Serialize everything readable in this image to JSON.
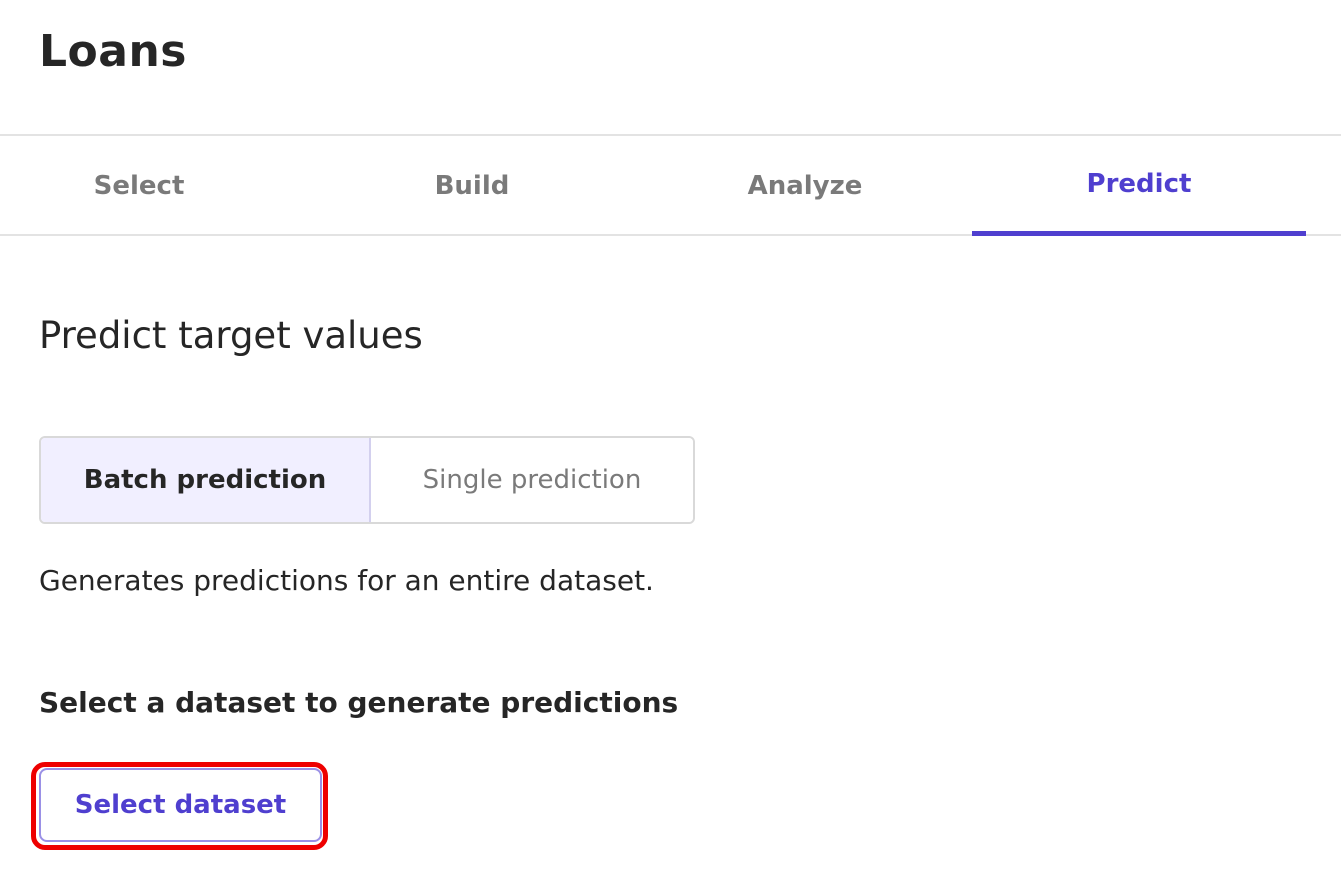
{
  "header": {
    "title": "Loans"
  },
  "tabs": [
    {
      "label": "Select",
      "active": false
    },
    {
      "label": "Build",
      "active": false
    },
    {
      "label": "Analyze",
      "active": false
    },
    {
      "label": "Predict",
      "active": true
    }
  ],
  "main": {
    "section_title": "Predict target values",
    "prediction_mode": {
      "options": [
        "Batch prediction",
        "Single prediction"
      ],
      "selected": "Batch prediction"
    },
    "description": "Generates predictions for an entire dataset.",
    "dataset_heading": "Select a dataset to generate predictions",
    "select_dataset_label": "Select dataset"
  },
  "colors": {
    "accent": "#4f3fcf",
    "selected_segment_bg": "#f1efff",
    "highlight": "#ee0000",
    "inactive_text": "#7a7a7a"
  }
}
